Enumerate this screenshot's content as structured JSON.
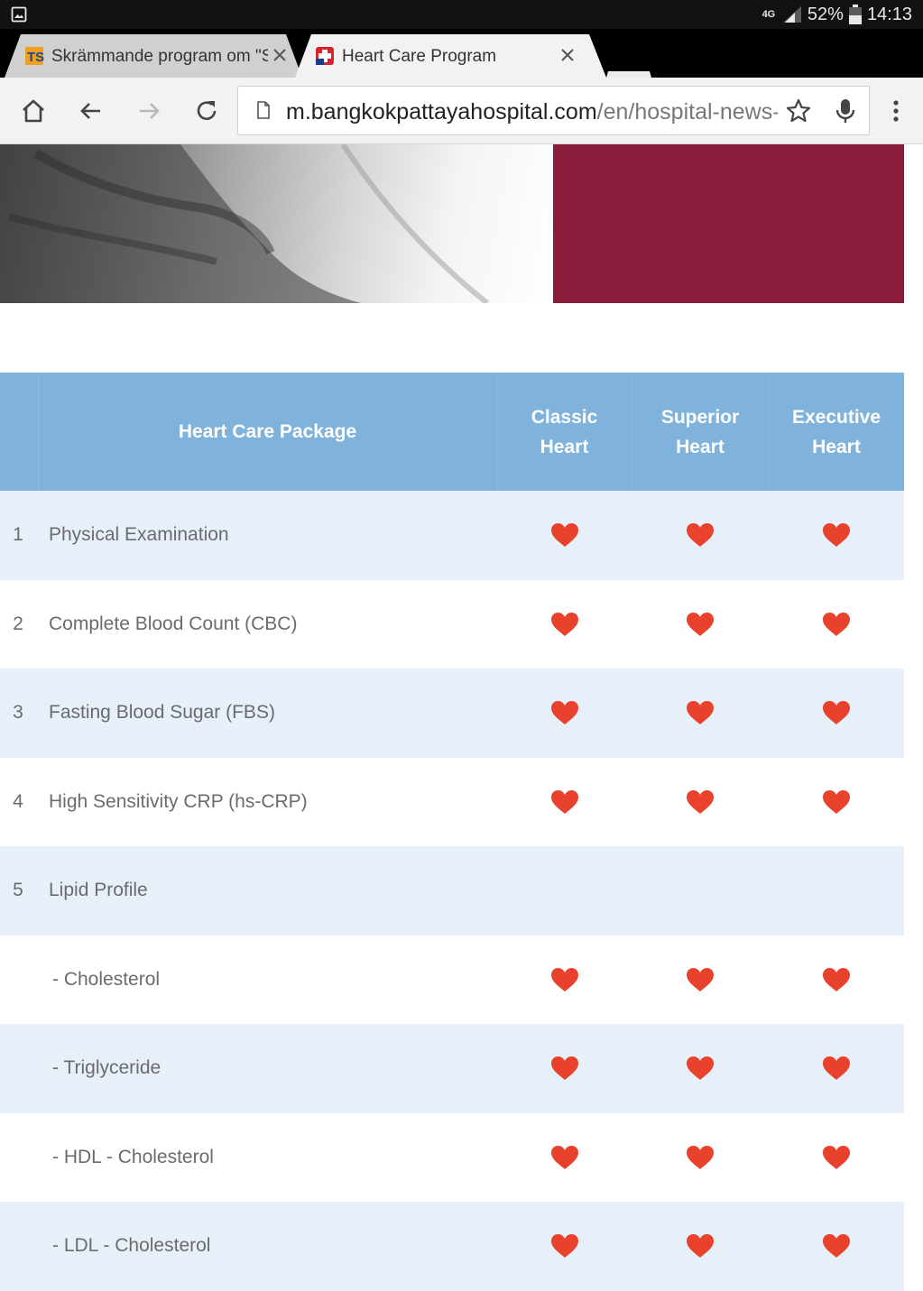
{
  "status_bar": {
    "network": "4G",
    "battery": "52%",
    "time": "14:13",
    "icons": [
      "screenshot-icon",
      "signal-icon",
      "battery-icon"
    ]
  },
  "tabs": [
    {
      "title": "Skrämmande program om \"S",
      "active": false,
      "favicon": "ts-favicon"
    },
    {
      "title": "Heart Care Program",
      "active": true,
      "favicon": "hospital-cross-favicon"
    }
  ],
  "toolbar": {
    "url_host": "m.bangkokpattayahospital.com",
    "url_path": "/en/hospital-news-",
    "icons": [
      "home-icon",
      "back-icon",
      "forward-icon",
      "reload-icon",
      "page-icon",
      "star-icon",
      "mic-icon",
      "menu-icon"
    ]
  },
  "colors": {
    "header_bg": "#7fb3dc",
    "row_shade": "#e7f0f9",
    "heart": "#e8412c",
    "hero_panel": "#8c1c3c"
  },
  "table": {
    "headers": {
      "package": "Heart Care Package",
      "classic": [
        "Classic",
        "Heart"
      ],
      "superior": [
        "Superior",
        "Heart"
      ],
      "executive": [
        "Executive",
        "Heart"
      ]
    },
    "rows": [
      {
        "num": "1",
        "name": "Physical Examination",
        "sub": false,
        "marks": [
          true,
          true,
          true
        ]
      },
      {
        "num": "2",
        "name": "Complete Blood Count (CBC)",
        "sub": false,
        "marks": [
          true,
          true,
          true
        ]
      },
      {
        "num": "3",
        "name": "Fasting Blood Sugar (FBS)",
        "sub": false,
        "marks": [
          true,
          true,
          true
        ]
      },
      {
        "num": "4",
        "name": "High Sensitivity CRP (hs-CRP)",
        "sub": false,
        "marks": [
          true,
          true,
          true
        ]
      },
      {
        "num": "5",
        "name": "Lipid Profile",
        "sub": false,
        "marks": [
          false,
          false,
          false
        ]
      },
      {
        "num": "",
        "name": "- Cholesterol",
        "sub": true,
        "marks": [
          true,
          true,
          true
        ]
      },
      {
        "num": "",
        "name": "- Triglyceride",
        "sub": true,
        "marks": [
          true,
          true,
          true
        ]
      },
      {
        "num": "",
        "name": "- HDL - Cholesterol",
        "sub": true,
        "marks": [
          true,
          true,
          true
        ]
      },
      {
        "num": "",
        "name": "- LDL - Cholesterol",
        "sub": true,
        "marks": [
          true,
          true,
          true
        ]
      }
    ]
  }
}
